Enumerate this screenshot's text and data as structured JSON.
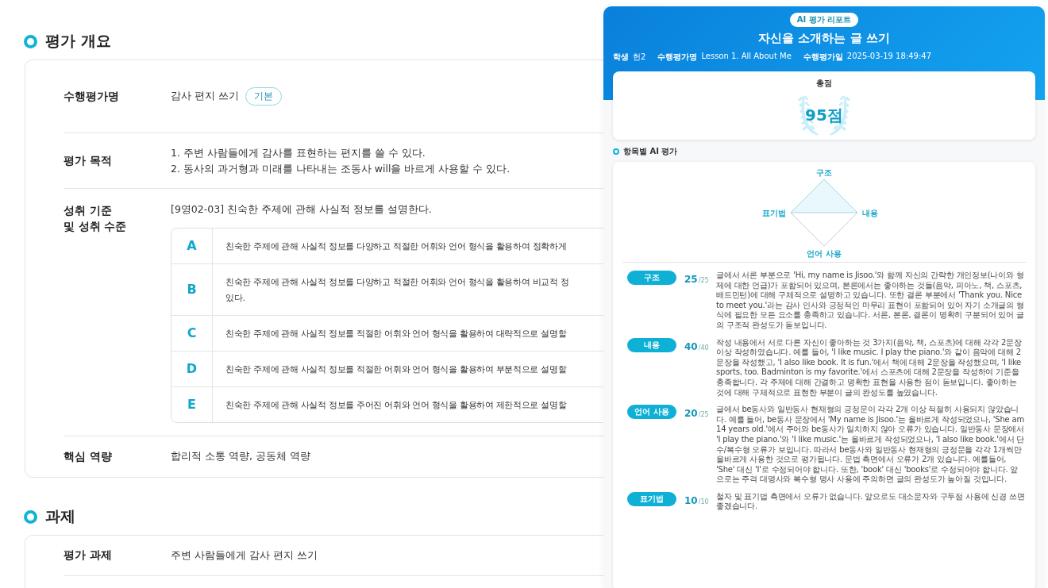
{
  "overview": {
    "heading": "평가 개요",
    "assessment_name": {
      "label": "수행평가명",
      "value": "감사 편지 쓰기",
      "tag": "기본"
    },
    "purpose": {
      "label": "평가 목적",
      "lines": [
        "1. 주변 사람들에게 감사를 표현하는 편지를 쓸 수 있다.",
        "2. 동사의 과거형과 미래를 나타내는 조동사 will을 바르게 사용할 수 있다."
      ]
    },
    "standard": {
      "label": "성취 기준\n및 성취 수준",
      "value": "[9영02-03] 친숙한 주제에 관해 사실적 정보를 설명한다.",
      "levels": [
        {
          "grade": "A",
          "text": "친숙한 주제에 관해 사실적 정보를 다양하고 적절한 어휘와 언어 형식을 활용하여 정확하게"
        },
        {
          "grade": "B",
          "text": "친숙한 주제에 관해 사실적 정보를 다양하고 적절한 어휘와 언어 형식을 활용하여 비교적 정\n있다."
        },
        {
          "grade": "C",
          "text": "친숙한 주제에 관해 사실적 정보를 적절한 어휘와 언어 형식을 활용하여 대략적으로 설명할"
        },
        {
          "grade": "D",
          "text": "친숙한 주제에 관해 사실적 정보를 적절한 어휘와 언어 형식을 활용하여 부분적으로 설명할"
        },
        {
          "grade": "E",
          "text": "친숙한 주제에 관해 사실적 정보를 주어진 어휘와 언어 형식을 활용하여 제한적으로 설명할"
        }
      ]
    },
    "competency": {
      "label": "핵심 역량",
      "value": "합리적 소통 역량, 공동체 역량"
    }
  },
  "task": {
    "heading": "과제",
    "rows": [
      {
        "label": "평가 과제",
        "value": "주변 사람들에게 감사 편지 쓰기"
      }
    ]
  },
  "report": {
    "badge": "AI 평가 리포트",
    "title": "자신을 소개하는 글 쓰기",
    "meta": [
      {
        "label": "학생",
        "value": "헌2"
      },
      {
        "label": "수행평가명",
        "value": "Lesson 1. All About Me"
      },
      {
        "label": "수행평가일",
        "value": "2025-03-19 18:49:47"
      }
    ],
    "total_label": "총점",
    "total": "95점",
    "section_heading": "항목별 AI 평가",
    "radar_labels": [
      "구조",
      "내용",
      "언어 사용",
      "표기법"
    ],
    "items": [
      {
        "name": "구조",
        "score": "25",
        "max": "/25",
        "comment": "글에서 서론 부분으로 'Hi, my name is Jisoo.'와 함께 자신의 간략한 개인정보(나이와 형제에 대한 언급)가 포함되어 있으며, 본론에서는 좋아하는 것들(음악, 피아노, 책, 스포츠, 배드민턴)에 대해 구체적으로 설명하고 있습니다. 또한 결론 부분에서 'Thank you. Nice to meet you.'라는 감사 인사와 긍정적인 마무리 표현이 포함되어 있어 자기 소개글의 형식에 필요한 모든 요소를 충족하고 있습니다. 서론, 본론, 결론이 명확히 구분되어 있어 글의 구조적 완성도가 돋보입니다."
      },
      {
        "name": "내용",
        "score": "40",
        "max": "/40",
        "comment": "작성 내용에서 서로 다른 자신이 좋아하는 것 3가지(음악, 책, 스포츠)에 대해 각각 2문장 이상 작성하였습니다. 예를 들어, 'I like music. I play the piano.'와 같이 음악에 대해 2문장을 작성했고, 'I also like book. It is fun.'에서 책에 대해 2문장을 작성했으며, 'I like sports, too. Badminton is my favorite.'에서 스포츠에 대해 2문장을 작성하여 기준을 충족합니다. 각 주제에 대해 간결하고 명확한 표현을 사용한 점이 돋보입니다. 좋아하는 것에 대해 구체적으로 표현한 부분이 글의 완성도를 높였습니다."
      },
      {
        "name": "언어 사용",
        "score": "20",
        "max": "/25",
        "comment": "글에서 be동사와 일반동사 현재형의 긍정문이 각각 2개 이상 적절히 사용되지 않았습니다. 예를 들어, be동사 문장에서 'My name is Jisoo.'는 올바르게 작성되었으나, 'She am 14 years old.'에서 주어와 be동사가 일치하지 않아 오류가 있습니다. 일반동사 문장에서 'I play the piano.'와 'I like music.'는 올바르게 작성되었으나, 'I also like book.'에서 단수/복수형 오류가 보입니다. 따라서 be동사와 일반동사 현재형의 긍정문을 각각 1개씩만 올바르게 사용한 것으로 평가됩니다. 문법 측면에서 오류가 2개 있습니다. 예를들어, 'She' 대신 'I'로 수정되어야 합니다. 또한, 'book' 대신 'books'로 수정되어야 합니다. 앞으로는 주격 대명사와 복수형 명사 사용에 주의하면 글의 완성도가 높아질 것입니다."
      },
      {
        "name": "표기법",
        "score": "10",
        "max": "/10",
        "comment": "철자 및 표기법 측면에서 오류가 없습니다. 앞으로도 대소문자와 구두점 사용에 신경 쓰면 좋겠습니다."
      }
    ]
  }
}
